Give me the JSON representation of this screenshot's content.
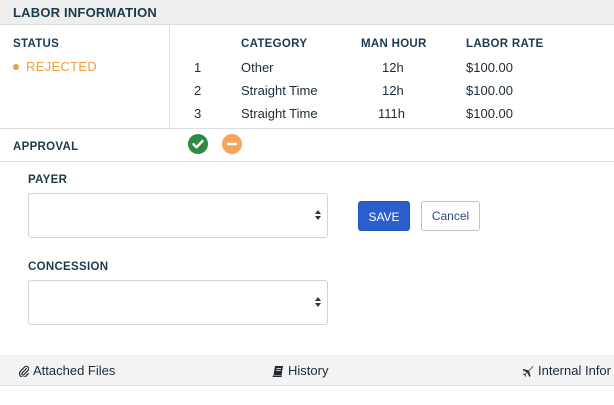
{
  "section": {
    "title": "LABOR INFORMATION"
  },
  "status": {
    "label": "STATUS",
    "value": "REJECTED",
    "color": "#f0a040"
  },
  "labor_table": {
    "headers": {
      "category": "CATEGORY",
      "man_hour": "MAN HOUR",
      "labor_rate": "LABOR RATE"
    },
    "rows": [
      {
        "index": "1",
        "category": "Other",
        "man_hour": "12h",
        "labor_rate": "$100.00"
      },
      {
        "index": "2",
        "category": "Straight Time",
        "man_hour": "12h",
        "labor_rate": "$100.00"
      },
      {
        "index": "3",
        "category": "Straight Time",
        "man_hour": "111h",
        "labor_rate": "$100.00"
      }
    ]
  },
  "approval": {
    "label": "APPROVAL",
    "approve_icon": "check-circle-icon",
    "reject_icon": "minus-circle-icon",
    "approve_color": "#2e8b43",
    "reject_color": "#f4a55a"
  },
  "form": {
    "payer_label": "PAYER",
    "payer_value": "",
    "concession_label": "CONCESSION",
    "concession_value": "",
    "save_label": "SAVE",
    "cancel_label": "Cancel",
    "save_color": "#2b5fd0"
  },
  "tabs": [
    {
      "label": "Attached Files",
      "icon": "paperclip-icon"
    },
    {
      "label": "History",
      "icon": "book-icon"
    },
    {
      "label": "Internal Infor",
      "icon": "airplane-icon"
    }
  ]
}
